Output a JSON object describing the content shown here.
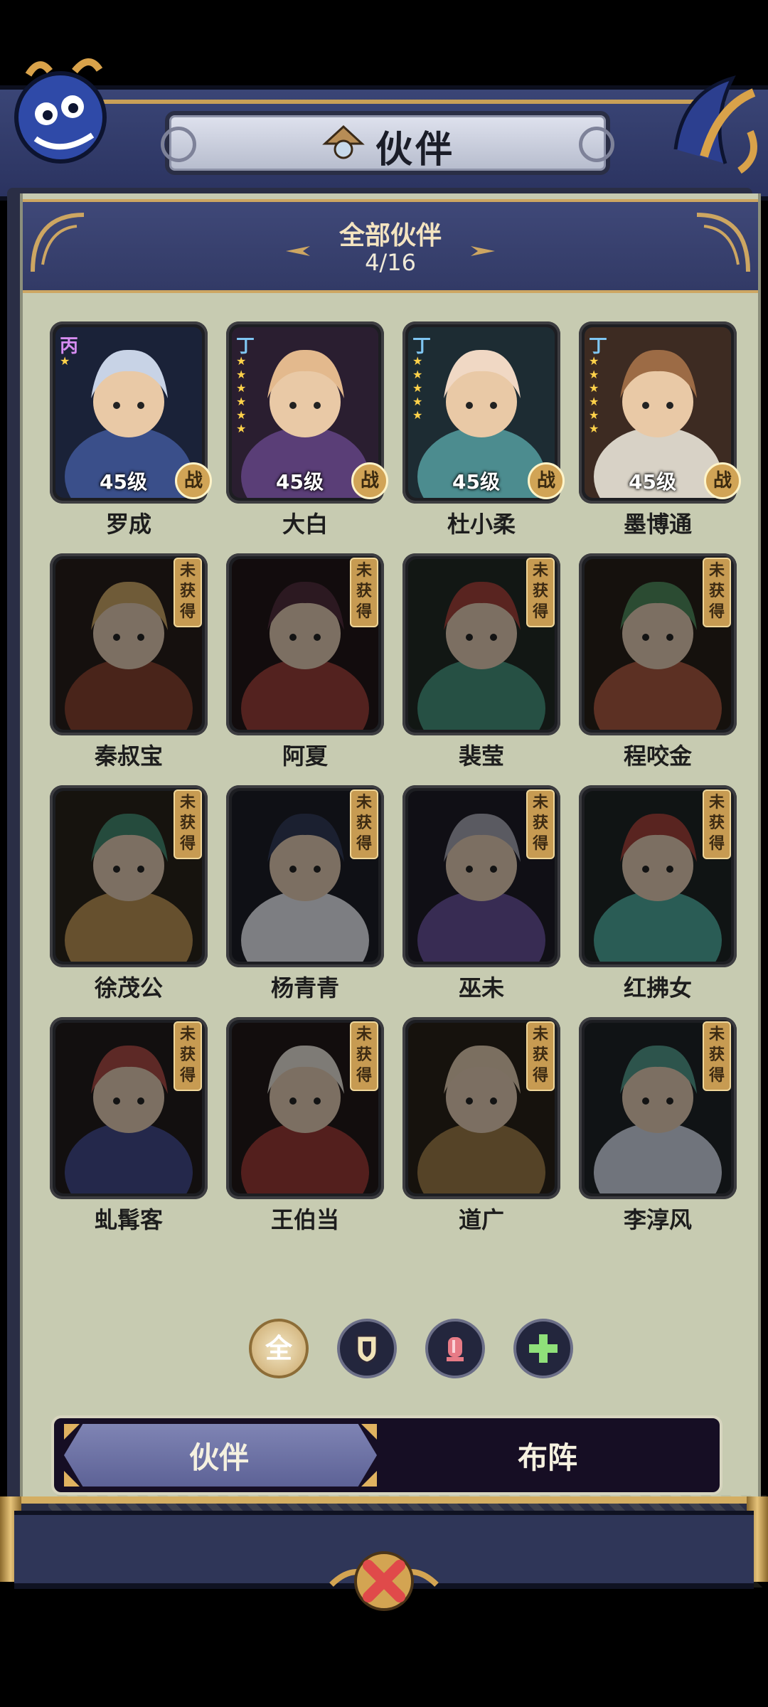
{
  "header": {
    "title": "伙伴"
  },
  "banner": {
    "title": "全部伙伴",
    "count": "4/16"
  },
  "cards": [
    {
      "name": "罗成",
      "grade": "丙",
      "stars": 1,
      "level": "45级",
      "badge": "战",
      "owned": true,
      "palette": [
        "#3a4f8a",
        "#c8d3e6",
        "#1a2238"
      ]
    },
    {
      "name": "大白",
      "grade": "丁",
      "stars": 6,
      "level": "45级",
      "badge": "战",
      "owned": true,
      "palette": [
        "#5a3e77",
        "#e3b98d",
        "#2a1e30"
      ]
    },
    {
      "name": "杜小柔",
      "grade": "丁",
      "stars": 5,
      "level": "45级",
      "badge": "战",
      "owned": true,
      "palette": [
        "#4c8c8f",
        "#f0d8c4",
        "#1d2c33"
      ]
    },
    {
      "name": "墨博通",
      "grade": "丁",
      "stars": 6,
      "level": "45级",
      "badge": "战",
      "owned": true,
      "palette": [
        "#d8d2c6",
        "#9c6b45",
        "#3d2b22"
      ]
    },
    {
      "name": "秦叔宝",
      "locked": "未获得",
      "owned": false,
      "palette": [
        "#9c3c22",
        "#d9a44a",
        "#2a1c18"
      ]
    },
    {
      "name": "阿夏",
      "locked": "未获得",
      "owned": false,
      "palette": [
        "#b5362e",
        "#5a2a3e",
        "#241417"
      ]
    },
    {
      "name": "裴莹",
      "locked": "未获得",
      "owned": false,
      "palette": [
        "#2c9a7a",
        "#c2392e",
        "#1d2a24"
      ]
    },
    {
      "name": "程咬金",
      "locked": "未获得",
      "owned": false,
      "palette": [
        "#c3512e",
        "#3c8f4e",
        "#2a1e14"
      ]
    },
    {
      "name": "徐茂公",
      "locked": "未获得",
      "owned": false,
      "palette": [
        "#c89038",
        "#2d8f6a",
        "#2a2316"
      ]
    },
    {
      "name": "杨青青",
      "locked": "未获得",
      "owned": false,
      "palette": [
        "#e2e6ee",
        "#2e3a64",
        "#1a1d2a"
      ]
    },
    {
      "name": "巫未",
      "locked": "未获得",
      "owned": false,
      "palette": [
        "#6a4cb2",
        "#a3a3b6",
        "#1e1a2a"
      ]
    },
    {
      "name": "红拂女",
      "locked": "未获得",
      "owned": false,
      "palette": [
        "#2fb09d",
        "#c2392e",
        "#1c2424"
      ]
    },
    {
      "name": "虬髯客",
      "locked": "未获得",
      "owned": false,
      "palette": [
        "#3d48a3",
        "#c9433a",
        "#221a1a"
      ]
    },
    {
      "name": "王伯当",
      "locked": "未获得",
      "owned": false,
      "palette": [
        "#b7302b",
        "#e8e0d2",
        "#231616"
      ]
    },
    {
      "name": "道广",
      "locked": "未获得",
      "owned": false,
      "palette": [
        "#a8792f",
        "#e7c9a2",
        "#2a2114"
      ]
    },
    {
      "name": "李淳风",
      "locked": "未获得",
      "owned": false,
      "palette": [
        "#c8d4e8",
        "#3aa08c",
        "#1c2228"
      ]
    }
  ],
  "filters": [
    {
      "label": "全",
      "icon": "all-icon",
      "active": true
    },
    {
      "icon": "shield-icon",
      "active": false
    },
    {
      "icon": "lamp-icon",
      "active": false
    },
    {
      "icon": "plus-icon",
      "active": false
    }
  ],
  "tabs": {
    "partner": "伙伴",
    "formation": "布阵"
  },
  "colors": {
    "accent": "#d1a456",
    "panel_bg": "#c7cbb1",
    "frame": "#2a2e45"
  }
}
